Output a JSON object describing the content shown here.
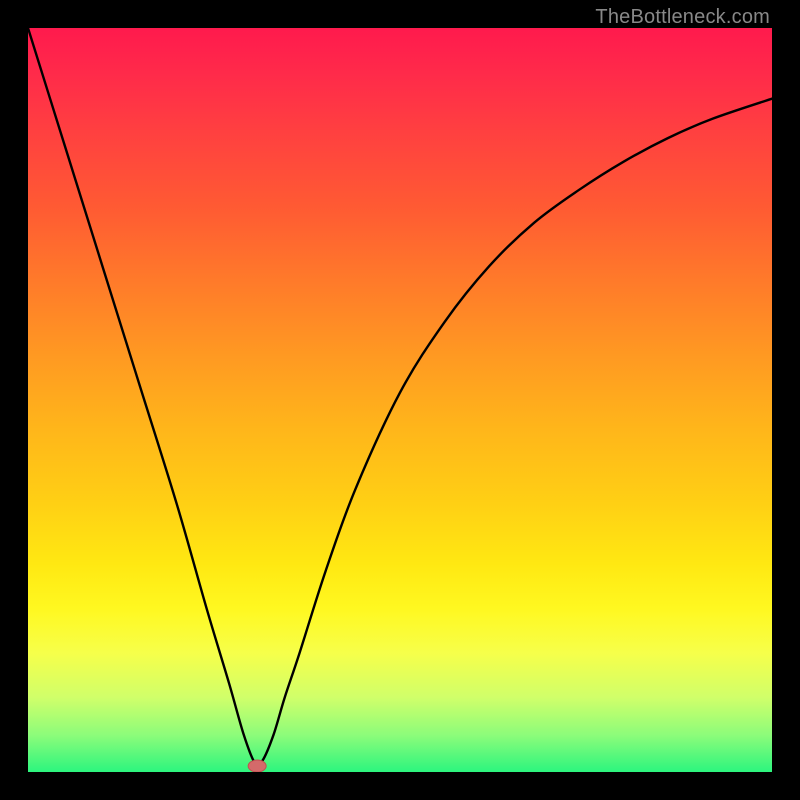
{
  "attribution": "TheBottleneck.com",
  "colors": {
    "frame": "#000000",
    "curve": "#000000",
    "marker_fill": "#d46a6a",
    "marker_stroke": "#c05050",
    "gradient_stops": [
      "#ff1a4d",
      "#ff2a4a",
      "#ff4040",
      "#ff5a33",
      "#ff7a2a",
      "#ff9922",
      "#ffb61a",
      "#ffd014",
      "#ffe812",
      "#fff820",
      "#f6ff4a",
      "#d0ff6a",
      "#8dfc7a",
      "#2cf57e"
    ]
  },
  "chart_data": {
    "type": "line",
    "title": "",
    "xlabel": "",
    "ylabel": "",
    "xlim": [
      0,
      1
    ],
    "ylim": [
      0,
      1
    ],
    "note": "Axes are unmarked in the source image; coordinates are normalized fractions of the plot-area (0,0)=top-left to (1,1)=bottom-right.",
    "series": [
      {
        "name": "bottleneck-curve",
        "x": [
          0.0,
          0.05,
          0.1,
          0.15,
          0.2,
          0.24,
          0.27,
          0.29,
          0.305,
          0.315,
          0.33,
          0.345,
          0.365,
          0.4,
          0.44,
          0.5,
          0.56,
          0.62,
          0.68,
          0.74,
          0.8,
          0.86,
          0.92,
          1.0
        ],
        "y": [
          0.0,
          0.16,
          0.32,
          0.48,
          0.64,
          0.78,
          0.88,
          0.95,
          0.988,
          0.985,
          0.95,
          0.9,
          0.84,
          0.73,
          0.62,
          0.49,
          0.395,
          0.32,
          0.262,
          0.218,
          0.18,
          0.148,
          0.122,
          0.095
        ]
      }
    ],
    "marker": {
      "name": "minimum-point",
      "x": 0.308,
      "y": 0.992
    }
  }
}
